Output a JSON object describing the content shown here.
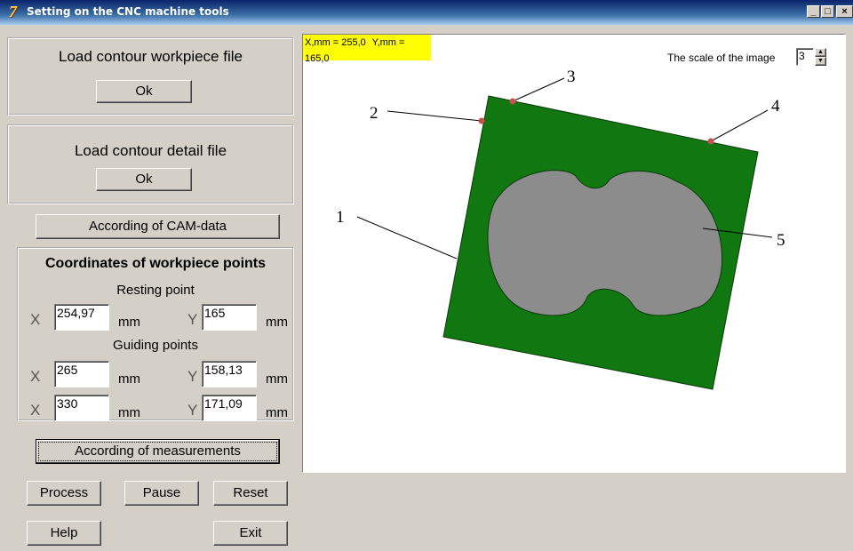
{
  "window": {
    "title": "Setting on the CNC machine tools",
    "minimize": "_",
    "maximize": "□",
    "close": "×"
  },
  "workpiece": {
    "title": "Load contour workpiece file",
    "ok": "Ok"
  },
  "detail": {
    "title": "Load contour detail file",
    "ok": "Ok"
  },
  "cam_button": "According of CAM-data",
  "coords": {
    "title": "Coordinates of workpiece points",
    "resting_label": "Resting point",
    "guiding_label": "Guiding points",
    "x_axis": "X",
    "y_axis": "Y",
    "unit": "mm",
    "resting_x": "254,97",
    "resting_y": "165",
    "guiding1_x": "265",
    "guiding1_y": "158,13",
    "guiding2_x": "330",
    "guiding2_y": "171,09"
  },
  "measure_button": "According of measurements",
  "buttons": {
    "process": "Process",
    "pause": "Pause",
    "reset": "Reset",
    "help": "Help",
    "exit": "Exit"
  },
  "view": {
    "x_readout": "X,mm = 255,0",
    "y_readout": "Y,mm =  165,0",
    "scale_label": "The scale of the image",
    "scale_value": "3",
    "callouts": [
      "1",
      "2",
      "3",
      "4",
      "5"
    ]
  },
  "colors": {
    "workpiece": "#117711",
    "detail": "#8c8c8c",
    "point": "#c85050",
    "readout_bg": "#ffff00"
  }
}
